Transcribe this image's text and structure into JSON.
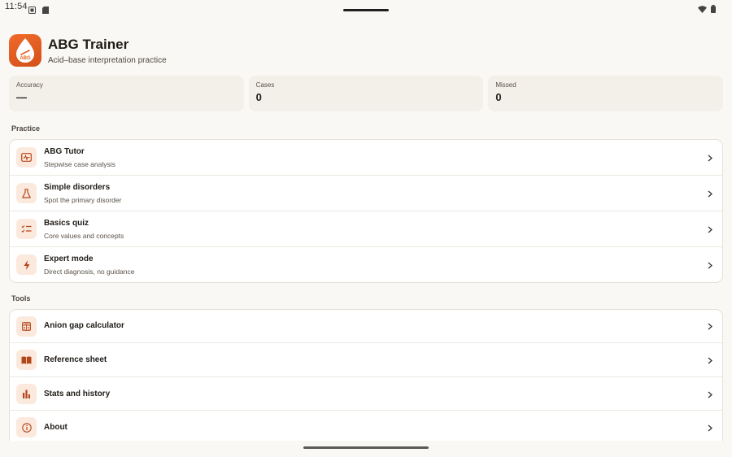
{
  "status": {
    "time": "11:54",
    "left_icons": [
      "notification-icon",
      "sd-card-icon"
    ],
    "right_icons": [
      "wifi-icon",
      "battery-icon"
    ]
  },
  "app": {
    "title": "ABG Trainer",
    "subtitle": "Acid–base interpretation practice",
    "icon_text": "ABG",
    "accent": "#e8601f"
  },
  "stats": [
    {
      "label": "Accuracy",
      "value": "—"
    },
    {
      "label": "Cases",
      "value": "0"
    },
    {
      "label": "Missed",
      "value": "0"
    }
  ],
  "practice": {
    "label": "Practice",
    "items": [
      {
        "title": "ABG Tutor",
        "subtitle": "Stepwise case analysis",
        "icon": "monitor-waveform-icon"
      },
      {
        "title": "Simple disorders",
        "subtitle": "Spot the primary disorder",
        "icon": "flask-icon"
      },
      {
        "title": "Basics quiz",
        "subtitle": "Core values and concepts",
        "icon": "checklist-icon"
      },
      {
        "title": "Expert mode",
        "subtitle": "Direct diagnosis, no guidance",
        "icon": "bolt-icon"
      }
    ]
  },
  "tools": {
    "label": "Tools",
    "items": [
      {
        "title": "Anion gap calculator",
        "icon": "calculator-icon"
      },
      {
        "title": "Reference sheet",
        "icon": "book-icon"
      },
      {
        "title": "Stats and history",
        "icon": "bar-chart-icon"
      },
      {
        "title": "About",
        "icon": "info-icon"
      }
    ]
  }
}
